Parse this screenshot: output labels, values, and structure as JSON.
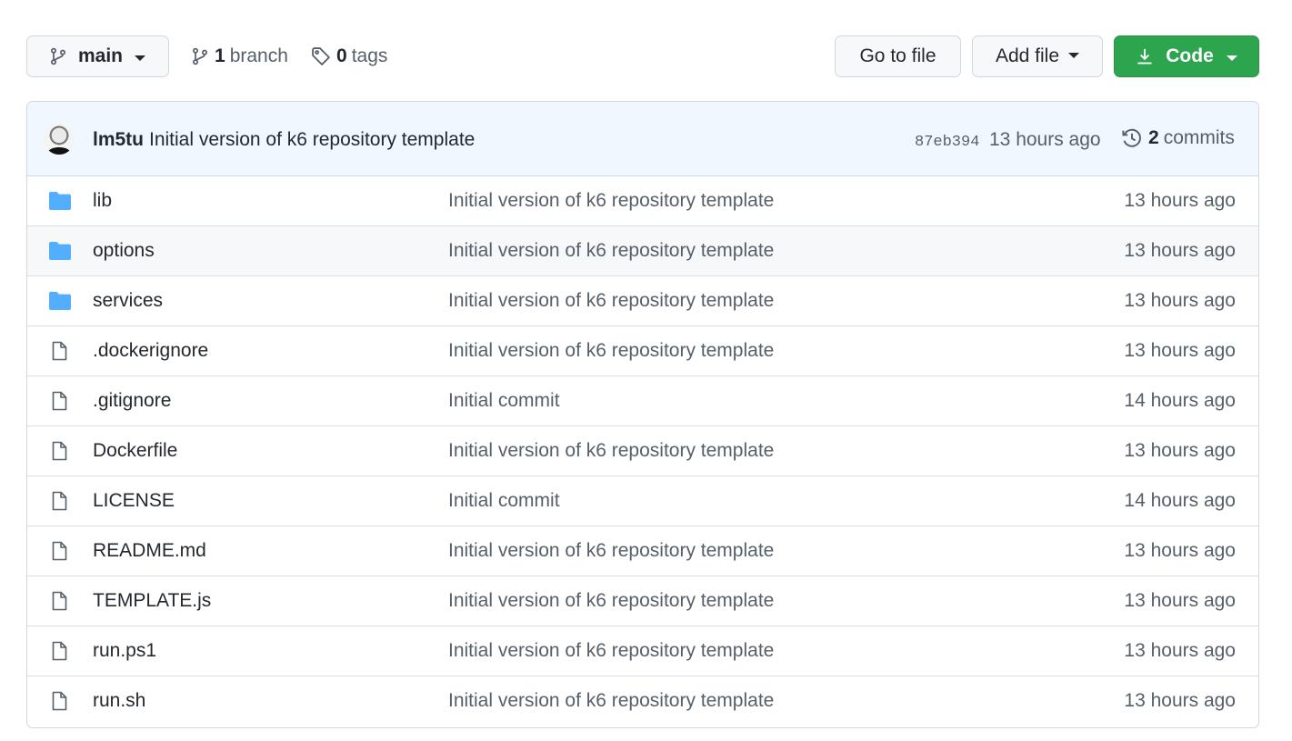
{
  "toolbar": {
    "branch_label": "main",
    "branches_count": "1",
    "branches_label": "branch",
    "tags_count": "0",
    "tags_label": "tags",
    "go_to_file_label": "Go to file",
    "add_file_label": "Add file",
    "code_label": "Code"
  },
  "latest_commit": {
    "author": "lm5tu",
    "message": "Initial version of k6 repository template",
    "sha": "87eb394",
    "time": "13 hours ago",
    "commits_count": "2",
    "commits_label": "commits"
  },
  "files": [
    {
      "name": "lib",
      "type": "folder",
      "message": "Initial version of k6 repository template",
      "age": "13 hours ago"
    },
    {
      "name": "options",
      "type": "folder",
      "message": "Initial version of k6 repository template",
      "age": "13 hours ago"
    },
    {
      "name": "services",
      "type": "folder",
      "message": "Initial version of k6 repository template",
      "age": "13 hours ago"
    },
    {
      "name": ".dockerignore",
      "type": "file",
      "message": "Initial version of k6 repository template",
      "age": "13 hours ago"
    },
    {
      "name": ".gitignore",
      "type": "file",
      "message": "Initial commit",
      "age": "14 hours ago"
    },
    {
      "name": "Dockerfile",
      "type": "file",
      "message": "Initial version of k6 repository template",
      "age": "13 hours ago"
    },
    {
      "name": "LICENSE",
      "type": "file",
      "message": "Initial commit",
      "age": "14 hours ago"
    },
    {
      "name": "README.md",
      "type": "file",
      "message": "Initial version of k6 repository template",
      "age": "13 hours ago"
    },
    {
      "name": "TEMPLATE.js",
      "type": "file",
      "message": "Initial version of k6 repository template",
      "age": "13 hours ago"
    },
    {
      "name": "run.ps1",
      "type": "file",
      "message": "Initial version of k6 repository template",
      "age": "13 hours ago"
    },
    {
      "name": "run.sh",
      "type": "file",
      "message": "Initial version of k6 repository template",
      "age": "13 hours ago"
    }
  ],
  "colors": {
    "folder": "#54aeff",
    "file_icon": "#57606a",
    "code_button": "#2da44e",
    "commit_header_bg": "#f0f7ff"
  },
  "icons": {
    "branch": "git-branch-icon",
    "tag": "tag-icon",
    "download": "download-icon",
    "history": "history-icon",
    "folder": "folder-icon",
    "file": "file-icon"
  }
}
